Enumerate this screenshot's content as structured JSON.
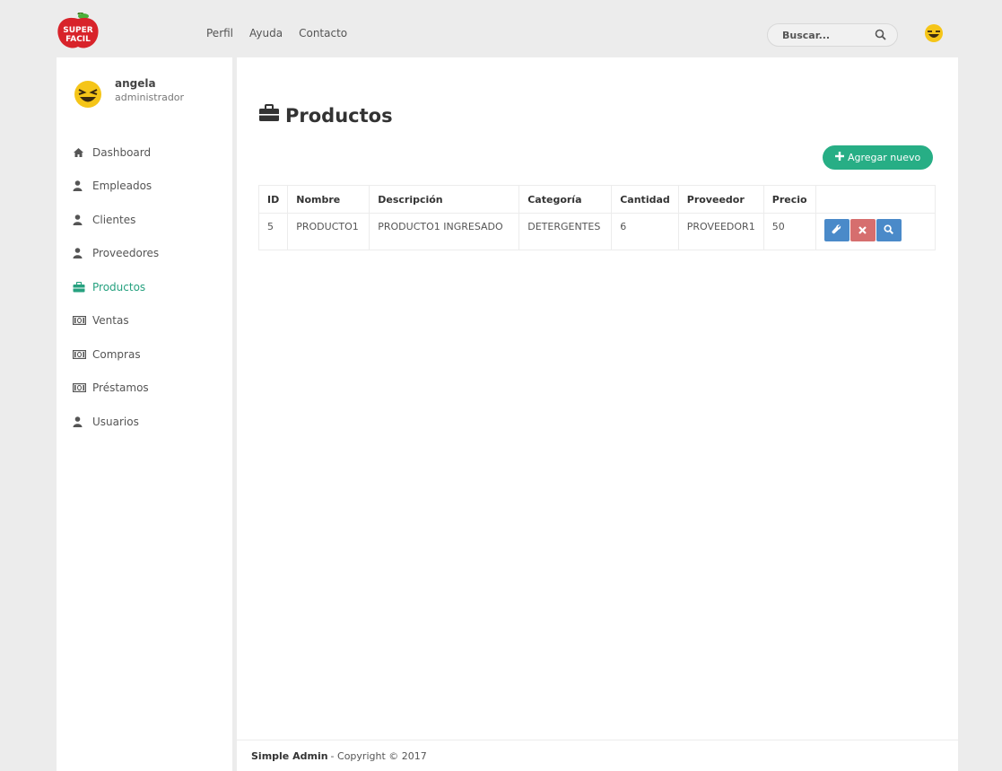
{
  "logo": {
    "line1": "SUPER",
    "line2": "FACIL"
  },
  "topnav": [
    "Perfil",
    "Ayuda",
    "Contacto"
  ],
  "search": {
    "placeholder": "Buscar..."
  },
  "user": {
    "name": "angela",
    "role": "administrador"
  },
  "menu": [
    {
      "label": "Dashboard",
      "icon": "home-icon"
    },
    {
      "label": "Empleados",
      "icon": "user-icon"
    },
    {
      "label": "Clientes",
      "icon": "user-icon"
    },
    {
      "label": "Proveedores",
      "icon": "user-icon"
    },
    {
      "label": "Productos",
      "icon": "briefcase-icon",
      "active": true
    },
    {
      "label": "Ventas",
      "icon": "money-icon"
    },
    {
      "label": "Compras",
      "icon": "money-icon"
    },
    {
      "label": "Préstamos",
      "icon": "money-icon"
    },
    {
      "label": "Usuarios",
      "icon": "user-icon"
    }
  ],
  "page": {
    "title": "Productos",
    "add_label": "Agregar nuevo"
  },
  "table": {
    "headers": [
      "ID",
      "Nombre",
      "Descripción",
      "Categoría",
      "Cantidad",
      "Proveedor",
      "Precio"
    ],
    "rows": [
      [
        "5",
        "PRODUCTO1",
        "PRODUCTO1 INGRESADO",
        "DETERGENTES",
        "6",
        "PROVEEDOR1",
        "50"
      ]
    ]
  },
  "footer": {
    "brand": "Simple Admin",
    "copyright": "- Copyright © 2017"
  },
  "colors": {
    "accent": "#27ae85",
    "edit": "#4a8ac9",
    "delete": "#d66e6e",
    "active_menu": "#26a17f"
  }
}
